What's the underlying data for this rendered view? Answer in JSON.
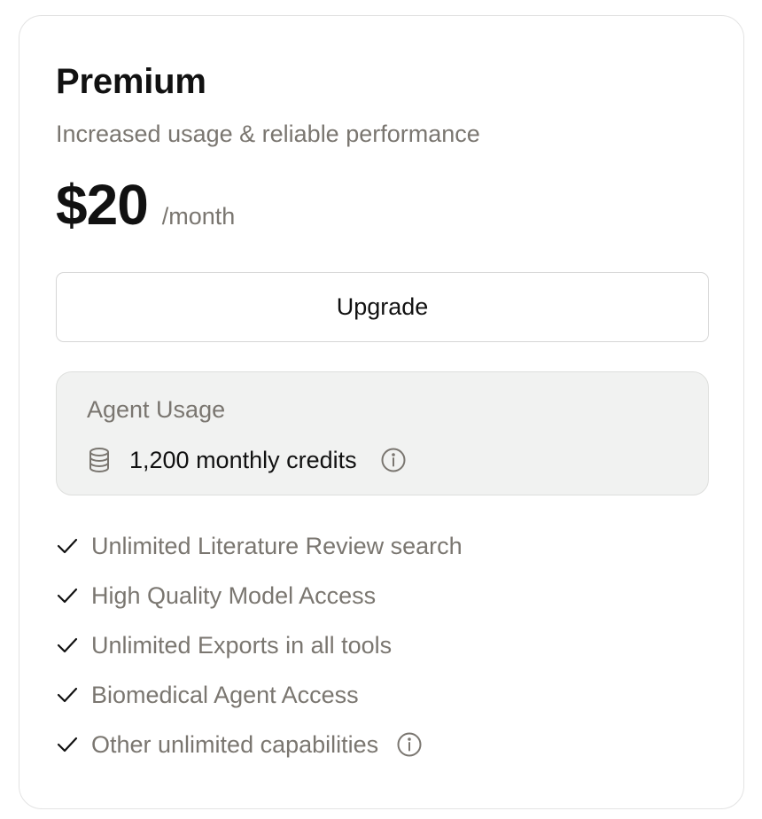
{
  "plan": {
    "title": "Premium",
    "subtitle": "Increased usage & reliable performance",
    "price": "$20",
    "period": "/month",
    "cta_label": "Upgrade"
  },
  "usage": {
    "label": "Agent Usage",
    "credits_text": "1,200 monthly credits",
    "icon": "database-icon",
    "info_icon": "info-icon"
  },
  "features": [
    {
      "text": "Unlimited Literature Review search",
      "icon": "check-icon",
      "has_info": false
    },
    {
      "text": "High Quality Model Access",
      "icon": "check-icon",
      "has_info": false
    },
    {
      "text": "Unlimited Exports in all tools",
      "icon": "check-icon",
      "has_info": false
    },
    {
      "text": "Biomedical Agent Access",
      "icon": "check-icon",
      "has_info": false
    },
    {
      "text": "Other unlimited capabilities",
      "icon": "check-icon",
      "has_info": true
    }
  ],
  "colors": {
    "text_primary": "#111111",
    "text_muted": "#7a7670",
    "card_border": "#e3e3e3",
    "usage_background": "#f1f2f1"
  }
}
